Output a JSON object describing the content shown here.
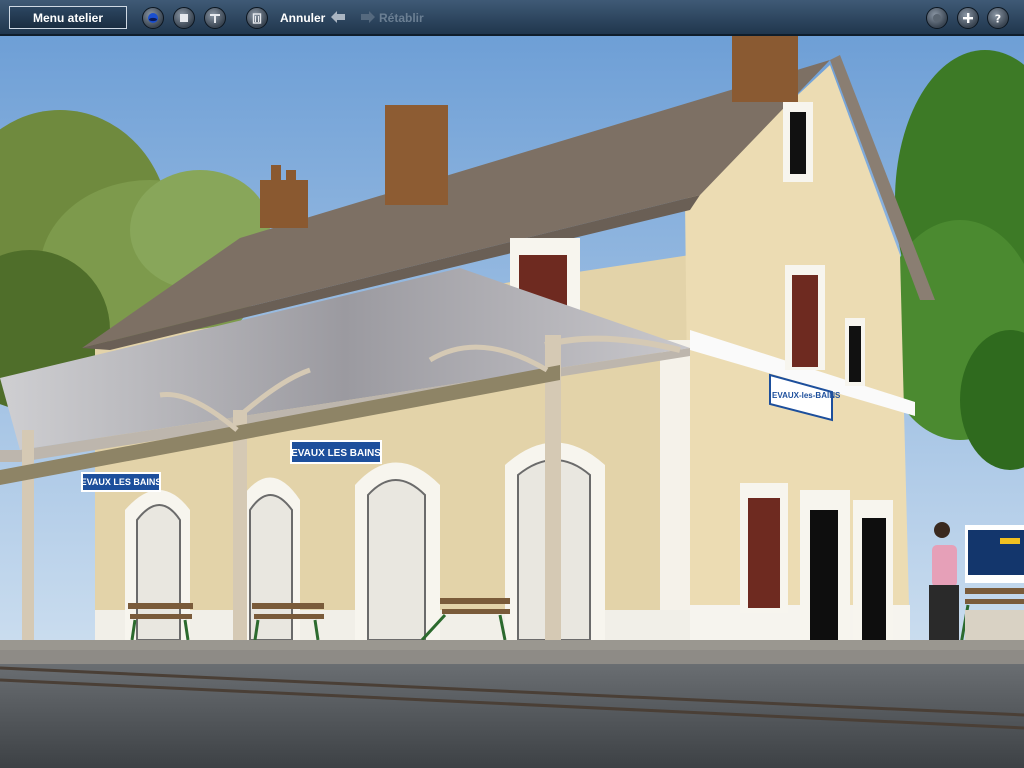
{
  "toolbar": {
    "menu_label": "Menu atelier",
    "undo_label": "Annuler",
    "redo_label": "Rétablir",
    "left_icons": [
      "globe-icon",
      "stop-icon",
      "tool-icon",
      "trash-icon"
    ],
    "right_icons": [
      "info-icon",
      "zoom-in-icon",
      "help-icon"
    ]
  },
  "scene": {
    "sign_canopy_front": "EVAUX LES BAINS",
    "sign_canopy_back": "EVAUX LES BAINS",
    "sign_building": "EVAUX-les-BAINS"
  },
  "colors": {
    "toolbar": "#2b4560",
    "wall": "#e3d3a9",
    "roof": "#7d7064",
    "sign": "#1d4f9c"
  }
}
